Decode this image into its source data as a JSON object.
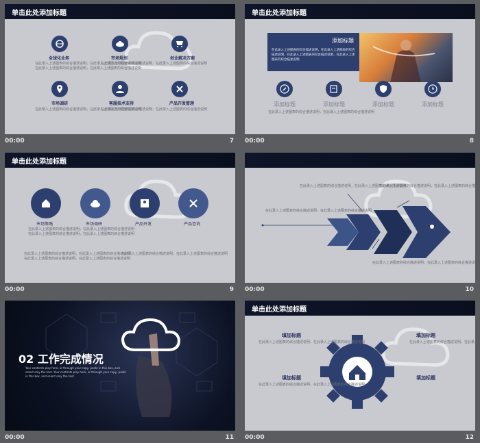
{
  "slides": [
    {
      "id": "s7",
      "title": "单击此处添加标题",
      "time": "00:00",
      "number": "7",
      "labels": [
        "全球化业务",
        "市场规划",
        "创业解决方案",
        "市场调研",
        "客服技术支持",
        "产品开发管理"
      ]
    },
    {
      "id": "s8",
      "title": "单击此处添加标题",
      "time": "00:00",
      "number": "8",
      "banner_title": "添加标题",
      "banner_text": "在此录入上述图表的综合描述说明，在此录入上述图表的综合描述说明，在此录入上述图表的综合描述说明，在此录入上述图表的综合描述说明",
      "labels": [
        "添加标题",
        "添加标题",
        "添加标题",
        "添加标题"
      ]
    },
    {
      "id": "s9",
      "title": "单击此处添加标题",
      "time": "00:00",
      "number": "9",
      "labels": [
        "市场策略",
        "市场调研",
        "产品开发",
        "产品咨询"
      ]
    },
    {
      "id": "s10",
      "time": "00:00",
      "number": "10"
    },
    {
      "id": "s11",
      "time": "00:00",
      "number": "11",
      "section_title": "02 工作完成情况",
      "section_sub": "Your contents play here, or through your copy, paste in this box, and select only the text. Your contents play here, or through your copy, paste in this box, and select only the text."
    },
    {
      "id": "s12",
      "title": "单击此处添加标题",
      "time": "00:00",
      "number": "12",
      "labels": [
        "填加标题",
        "填加标题",
        "填加标题",
        "填加标题"
      ]
    }
  ],
  "placeholder_text": "在此录入上述图表的综合描述说明，在此录入上述图表的综合描述说明",
  "colors": {
    "accent": "#2d3f6e",
    "header": "#0f1428",
    "slide_bg": "#c9cacf"
  }
}
